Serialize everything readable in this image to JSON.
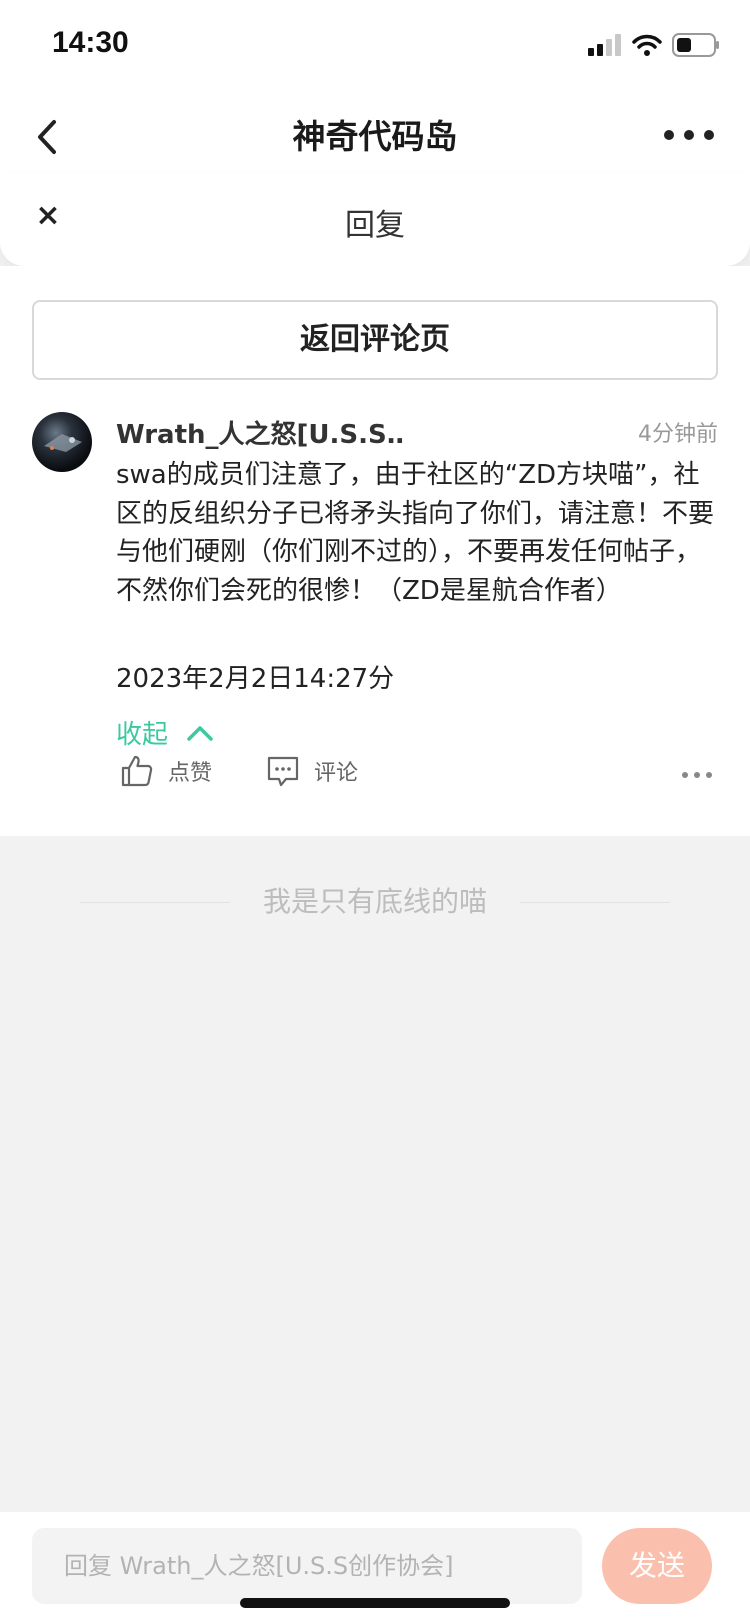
{
  "status_bar": {
    "time": "14:30"
  },
  "nav": {
    "title": "神奇代码岛"
  },
  "reply_panel": {
    "close_label": "×",
    "title": "回复",
    "back_to_comments": "返回评论页"
  },
  "comment": {
    "username": "Wrath_人之怒[U.S.S…",
    "time_ago": "4分钟前",
    "text": "swa的成员们注意了，由于社区的“ZD方块喵”，社区的反组织分子已将矛头指向了你们，请注意！不要与他们硬刚（你们刚不过的），不要再发任何帖子，不然你们会死的很惨！（ZD是星航合作者）",
    "date": "2023年2月2日14:27分",
    "collapse_label": "收起",
    "like_label": "点赞",
    "reply_label": "评论"
  },
  "footer_text": "我是只有底线的喵",
  "input": {
    "placeholder": "回复 Wrath_人之怒[U.S.S创作协会]",
    "value": "",
    "send_label": "发送"
  },
  "colors": {
    "accent_green": "#3cc9a0",
    "send_button": "#fbbfae"
  }
}
